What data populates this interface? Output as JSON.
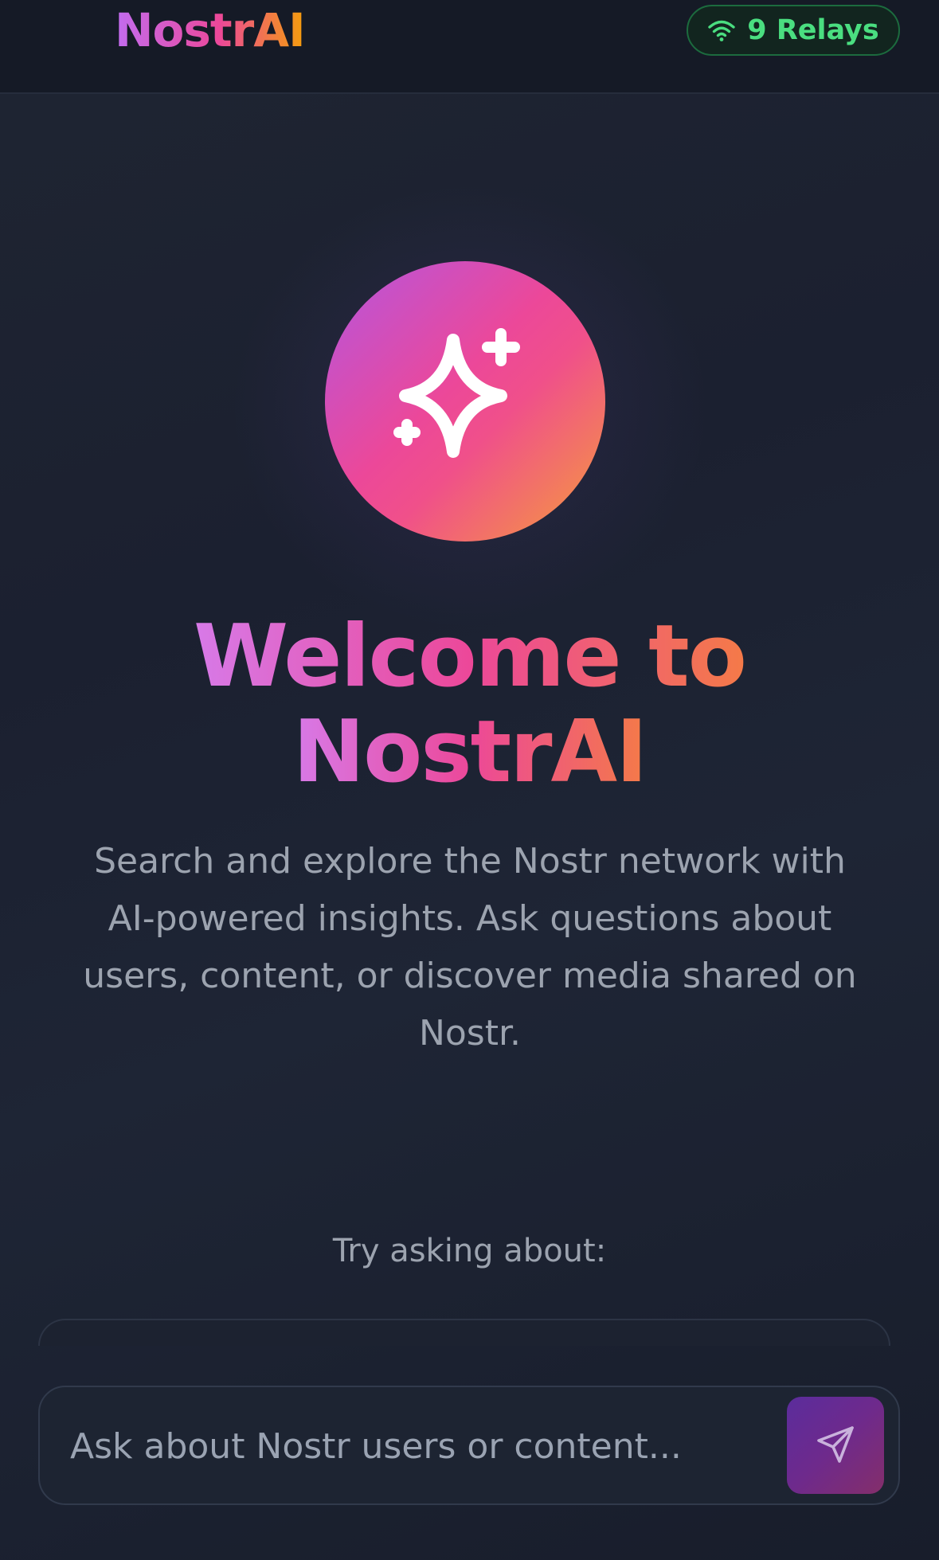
{
  "header": {
    "logo": "NostrAI",
    "relay_status": {
      "icon": "wifi-icon",
      "label": "9 Relays"
    }
  },
  "hero": {
    "icon": "sparkles-icon",
    "title_line1": "Welcome to",
    "title_line2": "NostrAI",
    "subtitle": "Search and explore the Nostr network with AI-powered insights. Ask questions about users, content, or discover media shared on Nostr."
  },
  "suggestions": {
    "label": "Try asking about:"
  },
  "composer": {
    "placeholder": "Ask about Nostr users or content...",
    "send_icon": "send-icon"
  },
  "colors": {
    "brand_gradient_start": "#c26cf0",
    "brand_gradient_mid": "#ec4899",
    "brand_gradient_end": "#f59e0b",
    "status_green": "#4ade80",
    "background": "#1b2030"
  }
}
